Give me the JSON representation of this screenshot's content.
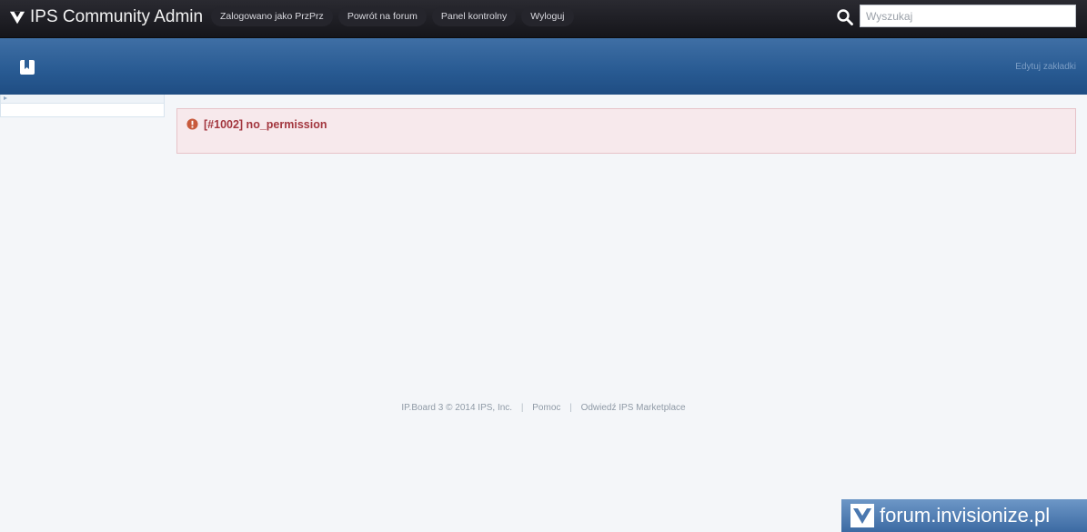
{
  "topbar": {
    "title": "IPS Community Admin",
    "nav": [
      {
        "label": "Zalogowano jako PrzPrz"
      },
      {
        "label": "Powrót na forum"
      },
      {
        "label": "Panel kontrolny"
      },
      {
        "label": "Wyloguj"
      }
    ],
    "search_placeholder": "Wyszukaj"
  },
  "header": {
    "edit_bookmarks": "Edytuj zakładki"
  },
  "error": {
    "message": "[#1002] no_permission"
  },
  "footer": {
    "copyright": "IP.Board 3 © 2014 IPS, Inc.",
    "help": "Pomoc",
    "marketplace": "Odwiedź IPS Marketplace",
    "separator": "|"
  },
  "watermark": {
    "text": "forum.invisionize.pl"
  },
  "colors": {
    "topbar": "#1c1c22",
    "header_band": "#285a92",
    "error_bg": "#f7e9ec",
    "error_text": "#a3373f"
  },
  "icons": {
    "brand": "ips-logo-icon",
    "search": "search-icon",
    "bookmark": "bookmark-icon",
    "error": "exclamation-circle-icon"
  }
}
